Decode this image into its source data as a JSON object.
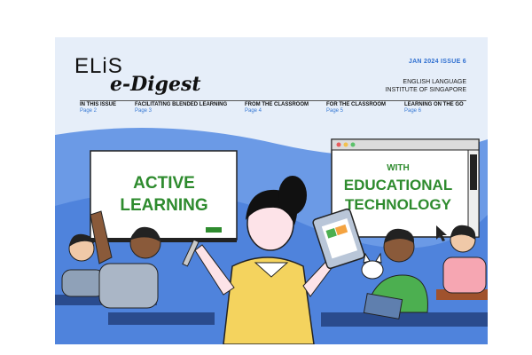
{
  "masthead": {
    "logo_text_primary": "ELiS",
    "logo_text_secondary": "e-Digest",
    "issue": "JAN 2024 ISSUE 6",
    "org_line1": "ENGLISH LANGUAGE",
    "org_line2": "INSTITUTE OF SINGAPORE"
  },
  "nav": [
    {
      "title": "IN THIS ISSUE",
      "page": "Page 2"
    },
    {
      "title": "FACILITATING BLENDED LEARNING",
      "page": "Page 3"
    },
    {
      "title": "FROM THE CLASSROOM",
      "page": "Page 4"
    },
    {
      "title": "FOR THE CLASSROOM",
      "page": "Page 5"
    },
    {
      "title": "LEARNING ON THE GO",
      "page": "Page 6"
    }
  ],
  "illustration": {
    "board_left_line1": "ACTIVE",
    "board_left_line2": "LEARNING",
    "board_right_line1": "WITH",
    "board_right_line2": "EDUCATIONAL",
    "board_right_line3": "TECHNOLOGY"
  },
  "colors": {
    "background": "#e6eef9",
    "accent_blue": "#2f6fd0",
    "board_green": "#2e8b2e",
    "wave_blue": "#5e8fe0"
  }
}
